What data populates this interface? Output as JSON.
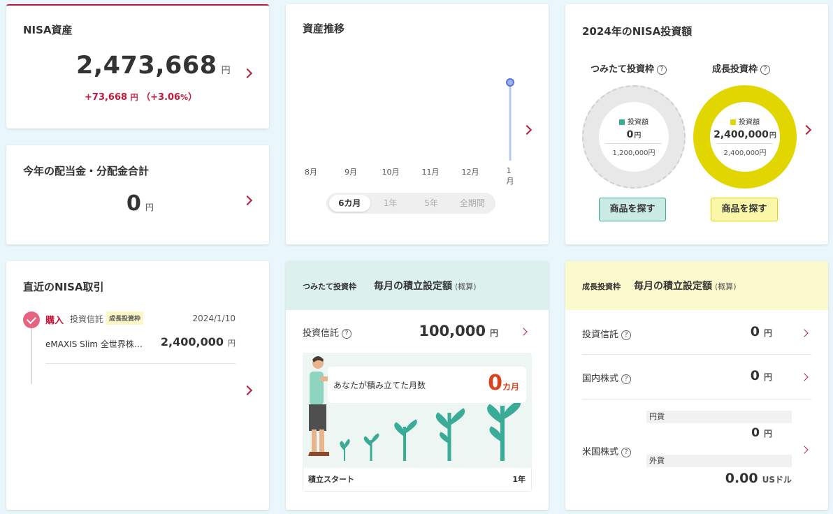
{
  "nisa_assets": {
    "title": "NISA資産",
    "value": "2,473,668",
    "unit": "円",
    "gain_value": "+73,668",
    "gain_unit": "円",
    "gain_pct_open": "（+3.06",
    "gain_pct_unit": "%",
    "gain_pct_close": "）"
  },
  "dividends": {
    "title": "今年の配当金・分配金合計",
    "value": "0",
    "unit": "円"
  },
  "asset_trend": {
    "title": "資産推移",
    "ranges": [
      "6カ月",
      "1年",
      "5年",
      "全期間"
    ],
    "active_range": 0
  },
  "chart_data": {
    "type": "line",
    "title": "資産推移",
    "categories": [
      "8月",
      "9月",
      "10月",
      "11月",
      "12月",
      "1月"
    ],
    "series": [
      {
        "values": [
          0,
          0,
          0,
          0,
          0,
          2473668
        ]
      }
    ],
    "grid": false,
    "color": "#5b74d9"
  },
  "investment_2024": {
    "title": "2024年のNISA投資額",
    "tsumitate": {
      "label": "つみたて投資枠",
      "legend": "投資額",
      "amount": "0",
      "unit": "円",
      "limit": "1,200,000円",
      "used_fraction": 0,
      "color": "#3aab96",
      "button": "商品を探す"
    },
    "growth": {
      "label": "成長投資枠",
      "legend": "投資額",
      "amount": "2,400,000",
      "unit": "円",
      "limit": "2,400,000円",
      "used_fraction": 1,
      "color": "#e2d600",
      "button": "商品を探す"
    }
  },
  "recent_trades": {
    "title": "直近のNISA取引",
    "items": [
      {
        "kind": "購入",
        "type": "投資信託",
        "badge": "成長投資枠",
        "date": "2024/1/10",
        "name": "eMAXIS Slim 全世界株…",
        "amount": "2,400,000",
        "unit": "円"
      }
    ]
  },
  "tsumitate_monthly": {
    "tag": "つみたて投資枠",
    "title": "毎月の積立設定額",
    "note": "(概算)",
    "row_label": "投資信託",
    "row_value": "100,000",
    "row_unit": "円",
    "months_label": "あなたが積み立てた月数",
    "months_value": "0",
    "months_unit": "カ月",
    "start_label": "積立スタート",
    "end_label": "1年"
  },
  "growth_monthly": {
    "tag": "成長投資枠",
    "title": "毎月の積立設定額",
    "note": "(概算)",
    "rows": [
      {
        "label": "投資信託",
        "value": "0",
        "unit": "円"
      },
      {
        "label": "国内株式",
        "value": "0",
        "unit": "円"
      }
    ],
    "us_stock": {
      "label": "米国株式",
      "yen_label": "円貨",
      "yen_value": "0",
      "yen_unit": "円",
      "fx_label": "外貨",
      "fx_value": "0.00",
      "fx_unit": "USドル"
    }
  },
  "help_icon": "?"
}
